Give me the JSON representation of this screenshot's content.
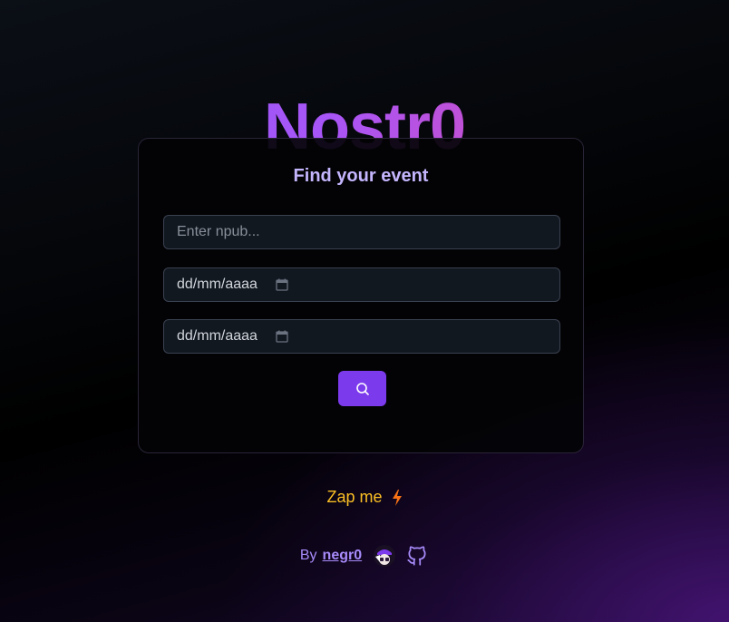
{
  "header": {
    "title": "Nostr0"
  },
  "card": {
    "title": "Find your event",
    "npub_placeholder": "Enter npub...",
    "start_date_placeholder": "dd/mm/aaaa",
    "end_date_placeholder": "dd/mm/aaaa",
    "search_icon": "search-icon",
    "calendar_icon": "calendar-icon"
  },
  "zap": {
    "label": "Zap me",
    "icon": "lightning-icon"
  },
  "footer": {
    "by_label": "By",
    "author": "negr0",
    "avatar_icon": "avatar",
    "github_icon": "github-icon"
  },
  "colors": {
    "accent": "#7c3aed",
    "title_gradient_start": "#8b5cf6",
    "title_gradient_end": "#ec4899",
    "zap": "#fbbf24",
    "link": "#a78bfa"
  }
}
